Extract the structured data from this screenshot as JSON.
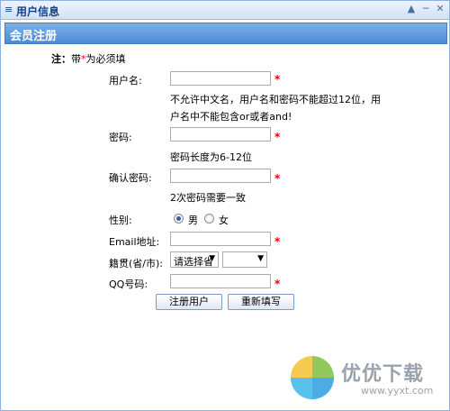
{
  "window": {
    "title": "用户信息",
    "menu_icon_glyph": "≡",
    "btn_up": "▲",
    "btn_min": "─",
    "btn_close": "✕"
  },
  "section": {
    "title": "会员注册"
  },
  "note": {
    "prefix": "注：",
    "text_a": "带",
    "star": "*",
    "text_b": "为必须填"
  },
  "form": {
    "username": {
      "label": "用户名:",
      "value": "",
      "hint_line1": "不允许中文名，用户名和密码不能超过12位，用",
      "hint_line2": "户名中不能包含or或者and!"
    },
    "password": {
      "label": "密码:",
      "value": "",
      "hint": "密码长度为6-12位"
    },
    "confirm_password": {
      "label": "确认密码:",
      "value": "",
      "hint": "2次密码需要一致"
    },
    "gender": {
      "label": "性别:",
      "options": [
        "男",
        "女"
      ],
      "selected": "男"
    },
    "email": {
      "label": "Email地址:",
      "value": ""
    },
    "region": {
      "label": "籍贯(省/市):",
      "province_value": "请选择省",
      "city_value": ""
    },
    "qq": {
      "label": "QQ号码:",
      "value": ""
    },
    "required_star": "*",
    "submit_label": "注册用户",
    "reset_label": "重新填写"
  },
  "watermark": {
    "brand": "优优下载",
    "url": "www.yyxt.com"
  }
}
